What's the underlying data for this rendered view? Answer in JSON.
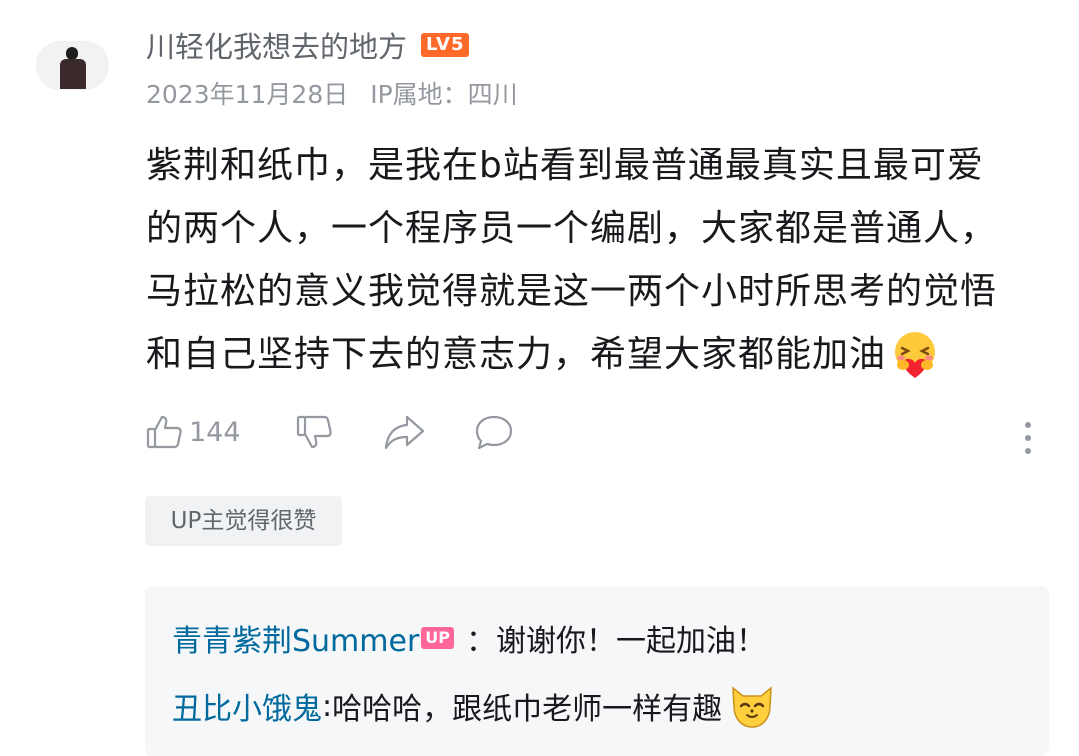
{
  "comment": {
    "username": "川轻化我想去的地方",
    "level_badge": "LV5",
    "date": "2023年11月28日",
    "ip_location": "IP属地：四川",
    "content_lines": [
      "紫荆和纸巾，是我在b站看到最普通最真实且最可爱",
      "的两个人，一个程序员一个编剧，大家都是普通人，",
      "马拉松的意义我觉得就是这一两个小时所思考的觉悟",
      "和自己坚持下去的意志力，希望大家都能加油"
    ],
    "content_emoji": "hug-heart-emoji",
    "like_count": "144",
    "up_tag": "UP主觉得很赞"
  },
  "replies": [
    {
      "user": "青青紫荆Summer",
      "badge": "UP",
      "text": "：谢谢你！一起加油！"
    },
    {
      "user": "丑比小饿鬼",
      "separator": ":",
      "text": " 哈哈哈，跟纸巾老师一样有趣",
      "emoji": "cat-emoji"
    }
  ],
  "icons": [
    "like-icon",
    "dislike-icon",
    "share-icon",
    "reply-icon",
    "more-icon"
  ],
  "colors": {
    "level_badge": "#ff6a2b",
    "up_badge": "#ff6699",
    "reply_user": "#00699d",
    "meta_text": "#9499a0"
  }
}
